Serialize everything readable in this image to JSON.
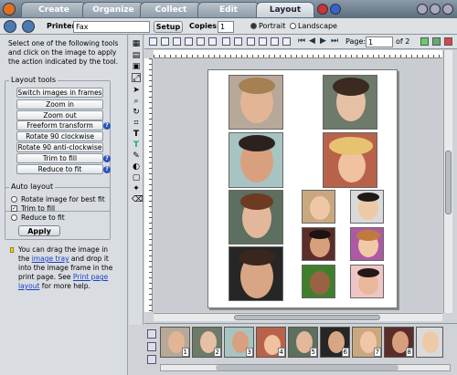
{
  "tabs": [
    {
      "label": "Create"
    },
    {
      "label": "Organize"
    },
    {
      "label": "Collect"
    },
    {
      "label": "Edit"
    },
    {
      "label": "Layout"
    }
  ],
  "toolbar": {
    "printer_label": "Printer",
    "printer_value": "Fax",
    "setup_label": "Setup",
    "copies_label": "Copies",
    "copies_value": "1",
    "portrait_label": "Portrait",
    "landscape_label": "Landscape",
    "page_label": "Page:",
    "page_value": "1",
    "page_of": "of 2"
  },
  "instructions": "Select one of the following tools and click on the image to apply the action indicated by the tool.",
  "layout_tools": {
    "title": "Layout tools",
    "buttons": [
      "Switch images in frames",
      "Zoom in",
      "Zoom out",
      "Freeform transform",
      "Rotate 90 clockwise",
      "Rotate 90 anti-clockwise",
      "Trim to fill",
      "Reduce to fit"
    ]
  },
  "auto_layout": {
    "title": "Auto layout",
    "options": [
      "Rotate image for best fit",
      "Trim to fill",
      "Reduce to fit"
    ],
    "selected": "Trim to fill",
    "apply_label": "Apply"
  },
  "tip": {
    "part1": "You can drag the image in the",
    "link1": "image tray",
    "part2": "and drop it into the image frame in the print page. See",
    "link2": "Print page layout",
    "part3": "for more help."
  },
  "tray_numbers": [
    "1",
    "2",
    "3",
    "4",
    "5",
    "6",
    "7",
    "8"
  ],
  "colors": {
    "accent": "#2a52be",
    "title_bar": "#5c6d7c"
  }
}
